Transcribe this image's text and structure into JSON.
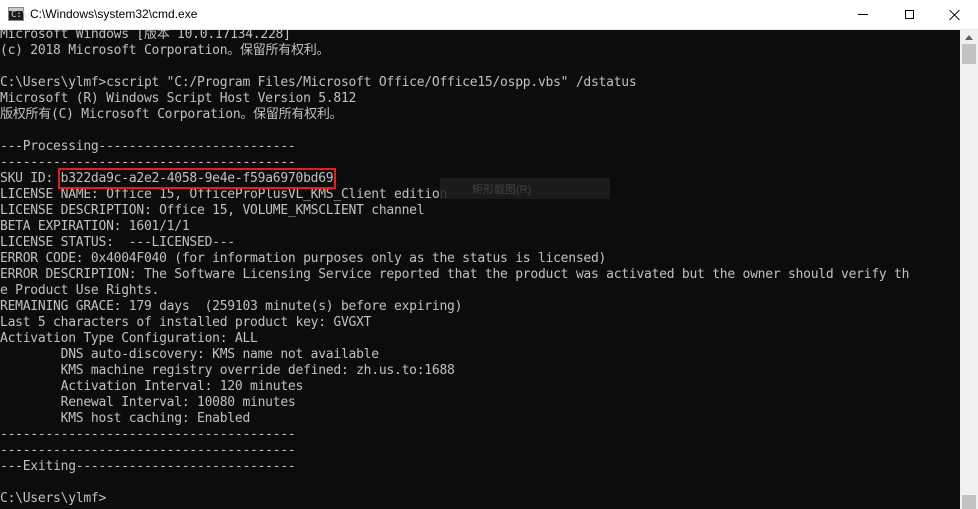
{
  "window": {
    "title": "C:\\Windows\\system32\\cmd.exe",
    "icon": "cmd-icon",
    "icon_text": "C:\\",
    "controls": [
      "minimize",
      "maximize",
      "close"
    ]
  },
  "console": {
    "text_color": "#c0c0c0",
    "background": "#0c0c0c",
    "highlight_color": "#e0201c",
    "sku_label": "SKU ID: ",
    "sku_id": "b322da9c-a2e2-4058-9e4e-f59a6970bd69",
    "lines_before": [
      "Microsoft Windows [版本 10.0.17134.228]",
      "(c) 2018 Microsoft Corporation。保留所有权利。",
      "",
      "C:\\Users\\ylmf>cscript \"C:/Program Files/Microsoft Office/Office15/ospp.vbs\" /dstatus",
      "Microsoft (R) Windows Script Host Version 5.812",
      "版权所有(C) Microsoft Corporation。保留所有权利。",
      "",
      "---Processing--------------------------",
      "---------------------------------------"
    ],
    "lines_after": [
      "LICENSE NAME: Office 15, OfficeProPlusVL_KMS_Client edition",
      "LICENSE DESCRIPTION: Office 15, VOLUME_KMSCLIENT channel",
      "BETA EXPIRATION: 1601/1/1",
      "LICENSE STATUS:  ---LICENSED---",
      "ERROR CODE: 0x4004F040 (for information purposes only as the status is licensed)",
      "ERROR DESCRIPTION: The Software Licensing Service reported that the product was activated but the owner should verify th",
      "e Product Use Rights.",
      "REMAINING GRACE: 179 days  (259103 minute(s) before expiring)",
      "Last 5 characters of installed product key: GVGXT",
      "Activation Type Configuration: ALL",
      "        DNS auto-discovery: KMS name not available",
      "        KMS machine registry override defined: zh.us.to:1688",
      "        Activation Interval: 120 minutes",
      "        Renewal Interval: 10080 minutes",
      "        KMS host caching: Enabled",
      "---------------------------------------",
      "---------------------------------------",
      "---Exiting-----------------------------",
      "",
      "C:\\Users\\ylmf>"
    ]
  },
  "ghost_menu": {
    "label": "矩形截图(R)"
  }
}
